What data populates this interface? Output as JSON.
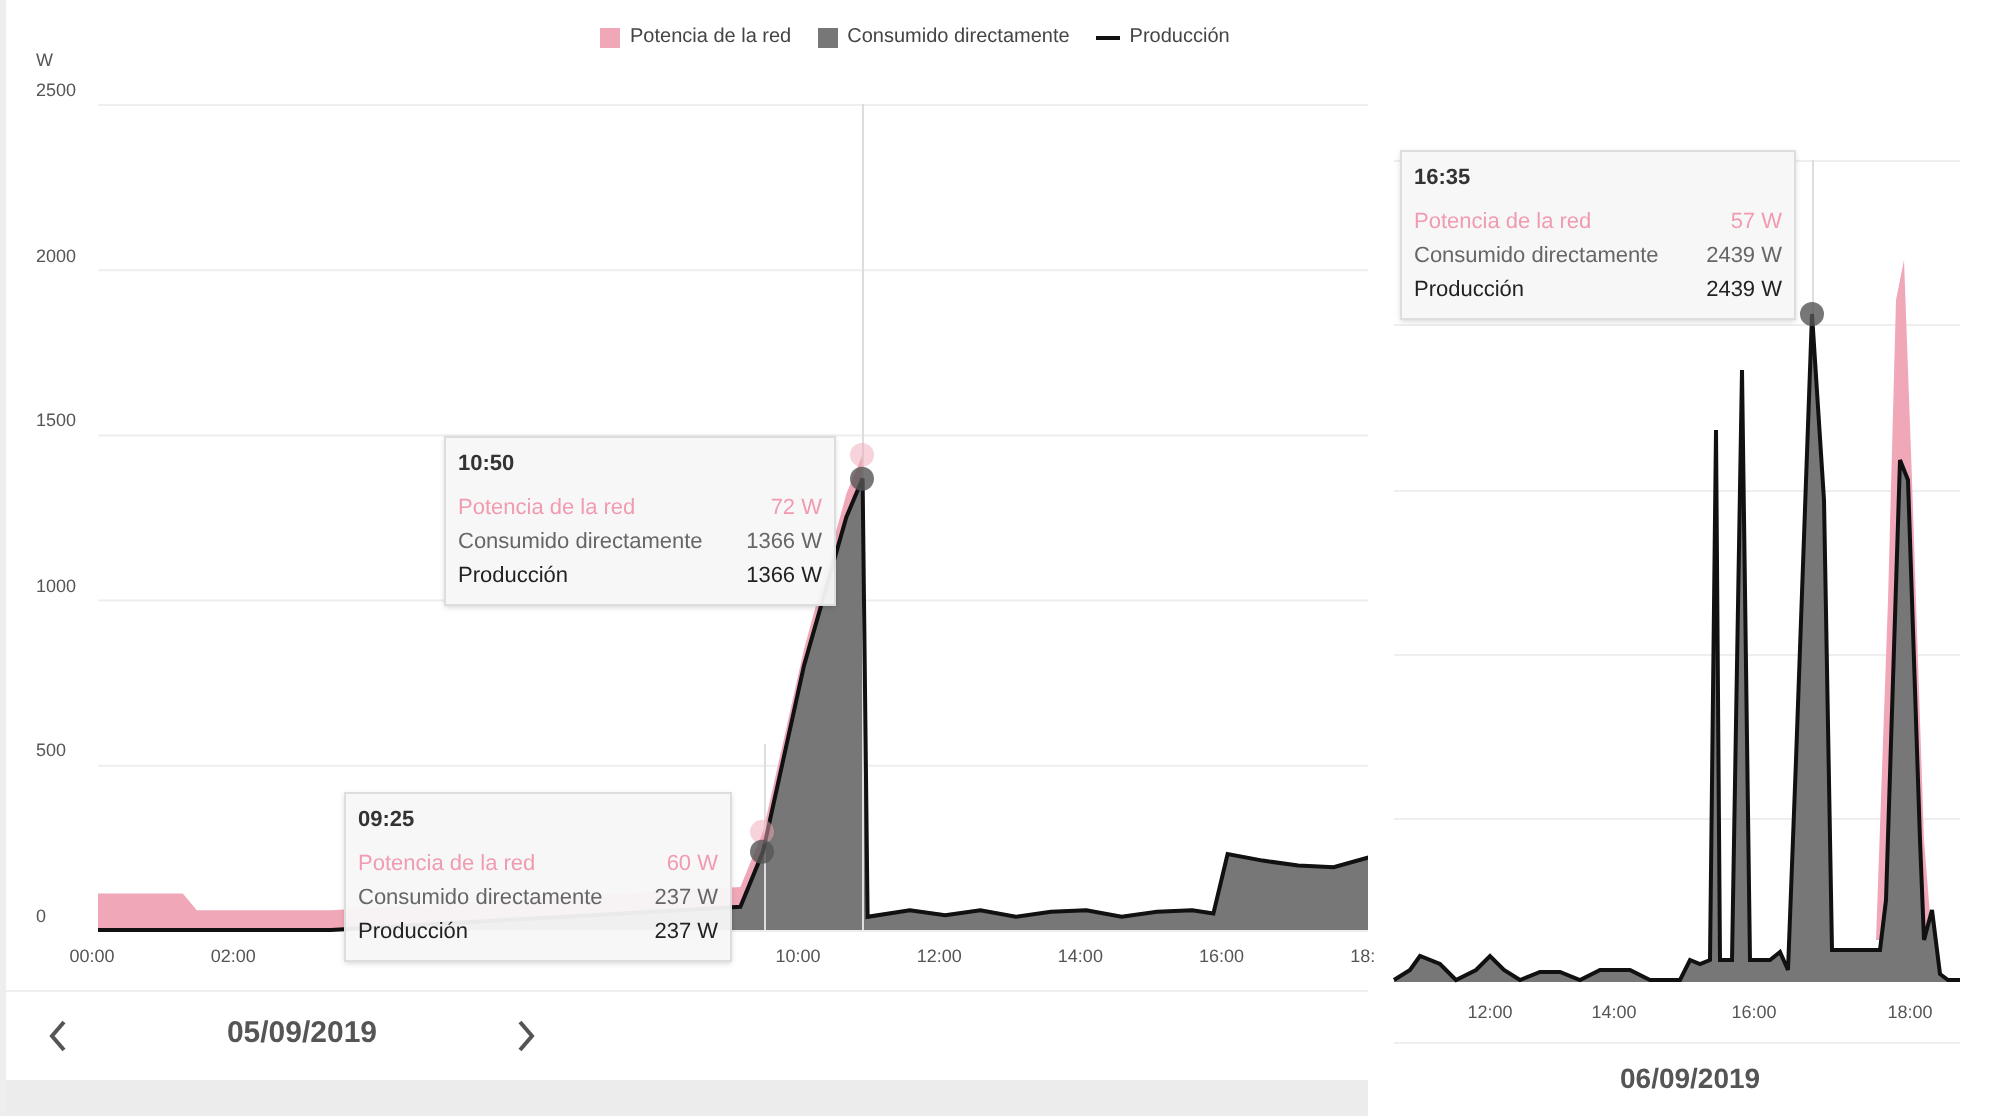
{
  "left_panel": {
    "production_legend": {
      "label": "Producción",
      "color": "#111111"
    },
    "chart_data": {
      "type": "area",
      "stacked": true,
      "grid": true,
      "legend": true,
      "ref_lines": [
        {
          "axis": "x",
          "value": 10.83
        },
        {
          "axis": "x",
          "value": 9.42
        }
      ],
      "ylabel": "W",
      "xlim": [
        0,
        18.1
      ],
      "ylim": [
        0,
        2500
      ],
      "x": [
        0,
        1.2,
        1.4,
        3.3,
        9.1,
        9.42,
        10.0,
        10.6,
        10.83,
        10.9,
        11.5,
        12,
        12.5,
        13,
        13.5,
        14,
        14.5,
        15,
        15.5,
        15.8,
        16,
        16.5,
        17,
        17.5,
        18,
        18.1
      ],
      "series": [
        {
          "name": "Consumido directamente",
          "color": "#777777",
          "values": [
            0,
            0,
            0,
            0,
            70,
            237,
            800,
            1250,
            1366,
            40,
            60,
            45,
            60,
            40,
            55,
            60,
            40,
            55,
            60,
            50,
            230,
            210,
            195,
            190,
            220,
            220
          ]
        },
        {
          "name": "Potencia de la red",
          "color": "#f0a8b8",
          "values": [
            110,
            110,
            60,
            60,
            60,
            60,
            50,
            70,
            72,
            5,
            5,
            5,
            5,
            5,
            5,
            5,
            5,
            5,
            5,
            5,
            5,
            5,
            5,
            5,
            5,
            5
          ]
        }
      ],
      "xticks": [
        {
          "value": 0,
          "label": "00:00"
        },
        {
          "value": 2,
          "label": "02:00"
        },
        {
          "value": 10,
          "label": "10:00"
        },
        {
          "value": 12,
          "label": "12:00"
        },
        {
          "value": 14,
          "label": "14:00"
        },
        {
          "value": 16,
          "label": "16:00"
        },
        {
          "value": 18,
          "label": "18:"
        }
      ],
      "yticks": [
        0,
        500,
        1000,
        1500,
        2000,
        2500
      ]
    },
    "tooltips": [
      {
        "time": "10:50",
        "rows": [
          {
            "kind": "grid",
            "label": "Potencia de la red",
            "value": "72 W"
          },
          {
            "kind": "direct",
            "label": "Consumido directamente",
            "value": "1366 W"
          },
          {
            "kind": "production",
            "label": "Producción",
            "value": "1366 W"
          }
        ]
      },
      {
        "time": "09:25",
        "rows": [
          {
            "kind": "grid",
            "label": "Potencia de la red",
            "value": "60 W"
          },
          {
            "kind": "direct",
            "label": "Consumido directamente",
            "value": "237 W"
          },
          {
            "kind": "production",
            "label": "Producción",
            "value": "237 W"
          }
        ]
      }
    ],
    "date": "05/09/2019"
  },
  "right_panel": {
    "tooltip": {
      "time": "16:35",
      "rows": [
        {
          "kind": "grid",
          "label": "Potencia de la red",
          "value": "57 W"
        },
        {
          "kind": "direct",
          "label": "Consumido directamente",
          "value": "2439 W"
        },
        {
          "kind": "production",
          "label": "Producción",
          "value": "2439 W"
        }
      ]
    },
    "xticks": [
      "12:00",
      "14:00",
      "16:00",
      "18:00"
    ],
    "date": "06/09/2019"
  }
}
